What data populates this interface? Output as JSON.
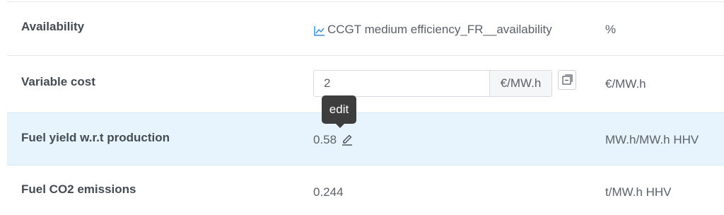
{
  "rows": [
    {
      "label": "Availability",
      "value_link": "CCGT medium efficiency_FR__availability",
      "value_icon": "line-chart-icon",
      "unit": "%"
    },
    {
      "label": "Variable cost",
      "input_value": "2",
      "input_addon": "€/MW.h",
      "action_icon": "copy-icon",
      "unit": "€/MW.h"
    },
    {
      "label": "Fuel yield w.r.t production",
      "value": "0.58",
      "action_icon": "pencil-icon",
      "unit": "MW.h/MW.h HHV",
      "highlighted": true
    },
    {
      "label": "Fuel CO2 emissions",
      "value": "0.244",
      "unit": "t/MW.h HHV"
    }
  ],
  "tooltip": {
    "text": "edit"
  },
  "colors": {
    "highlight_row": "#e8f4fd",
    "link_icon": "#3b8fd9",
    "tooltip_bg": "#3d3d3d"
  }
}
